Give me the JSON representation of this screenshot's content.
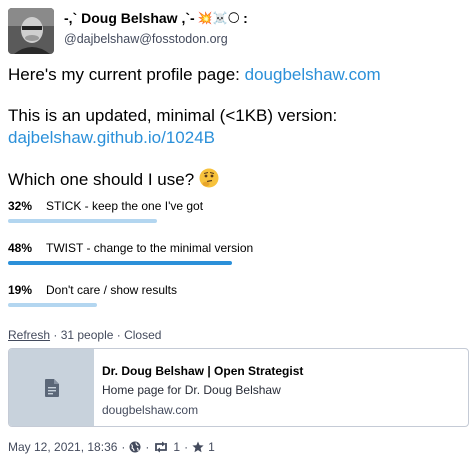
{
  "author": {
    "display_name": "-,` Doug Belshaw ,`-",
    "name_emoji": "💥☠️🌕",
    "handle": "@dajbelshaw@fosstodon.org"
  },
  "content": {
    "line1_text": "Here's my current profile page: ",
    "line1_link": "dougbelshaw.com",
    "line2_text": "This is an updated, minimal (<1KB) version:",
    "line2_link": "dajbelshaw.github.io/1024B",
    "line3_text": "Which one should I use?"
  },
  "poll": {
    "options": [
      {
        "percent": "32%",
        "label": "STICK - keep the one I've got",
        "fraction": 0.32,
        "leading": false
      },
      {
        "percent": "48%",
        "label": "TWIST - change to the minimal version",
        "fraction": 0.48,
        "leading": true
      },
      {
        "percent": "19%",
        "label": "Don't care / show results",
        "fraction": 0.19,
        "leading": false
      }
    ],
    "refresh_label": "Refresh",
    "summary": " · 31 people · Closed"
  },
  "card": {
    "title": "Dr. Doug Belshaw | Open Strategist",
    "description": "Home page for Dr. Doug Belshaw",
    "url": "dougbelshaw.com",
    "icon": "document-icon"
  },
  "meta": {
    "date": "May 12, 2021, 18:36",
    "boost_count": "1",
    "favourite_count": "1"
  },
  "colors": {
    "link": "#2b90d9",
    "bar_leading": "#2b90d9",
    "bar_other": "#b3d6f0"
  }
}
